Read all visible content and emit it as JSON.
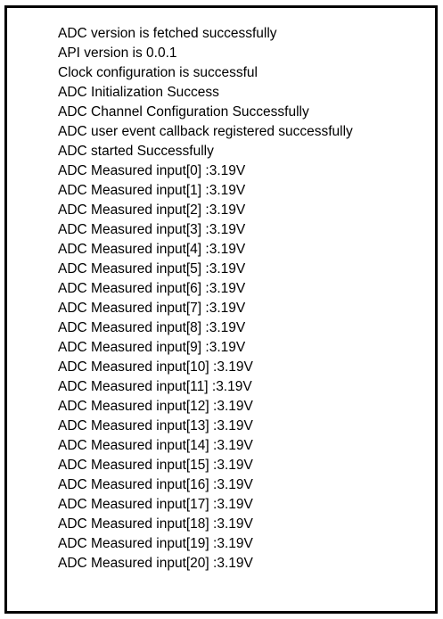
{
  "console": {
    "lines": [
      "ADC version is fetched successfully",
      "API version is 0.0.1",
      "Clock configuration is successful",
      "ADC Initialization Success",
      "ADC Channel Configuration Successfully",
      "ADC user event callback registered successfully",
      "ADC started Successfully",
      "ADC Measured input[0] :3.19V",
      "ADC Measured input[1] :3.19V",
      "ADC Measured input[2] :3.19V",
      "ADC Measured input[3] :3.19V",
      "ADC Measured input[4] :3.19V",
      "ADC Measured input[5] :3.19V",
      "ADC Measured input[6] :3.19V",
      "ADC Measured input[7] :3.19V",
      "ADC Measured input[8] :3.19V",
      "ADC Measured input[9] :3.19V",
      "ADC Measured input[10] :3.19V",
      "ADC Measured input[11] :3.19V",
      "ADC Measured input[12] :3.19V",
      "ADC Measured input[13] :3.19V",
      "ADC Measured input[14] :3.19V",
      "ADC Measured input[15] :3.19V",
      "ADC Measured input[16] :3.19V",
      "ADC Measured input[17] :3.19V",
      "ADC Measured input[18] :3.19V",
      "ADC Measured input[19] :3.19V",
      "ADC Measured input[20] :3.19V"
    ]
  }
}
